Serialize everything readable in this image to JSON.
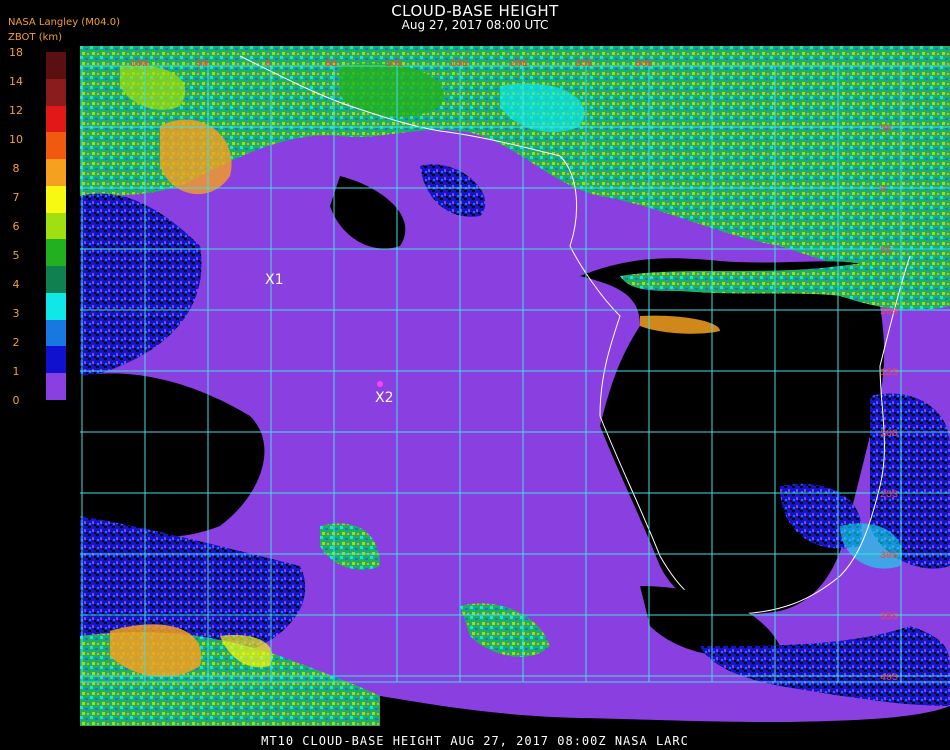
{
  "title": "CLOUD-BASE HEIGHT",
  "subtitle": "Aug 27, 2017 08:00 UTC",
  "source": "NASA Langley (M04.0)",
  "units_label": "ZBOT (km)",
  "footer": "MT10  CLOUD-BASE HEIGHT   AUG 27, 2017 08:00Z   NASA LARC",
  "legend": {
    "labels": [
      "18",
      "14",
      "12",
      "10",
      "8",
      "7",
      "6",
      "5",
      "4",
      "3",
      "2",
      "1",
      "0"
    ],
    "colors": [
      "#5a1010",
      "#8b1c1c",
      "#e01818",
      "#f05a10",
      "#f6a020",
      "#f8f810",
      "#a0e010",
      "#20b020",
      "#108050",
      "#10e8e8",
      "#1878e0",
      "#1010d0",
      "#8a40e0"
    ]
  },
  "markers": [
    {
      "label": "X1"
    },
    {
      "label": "X2"
    }
  ],
  "lat_labels": [
    "5N",
    "0",
    "5S",
    "10S",
    "15S",
    "20S",
    "25S",
    "30S",
    "35S",
    "40S"
  ],
  "lon_labels": [
    "10W",
    "5W",
    "0",
    "5E",
    "10E",
    "15E",
    "20E",
    "25E",
    "30E"
  ]
}
